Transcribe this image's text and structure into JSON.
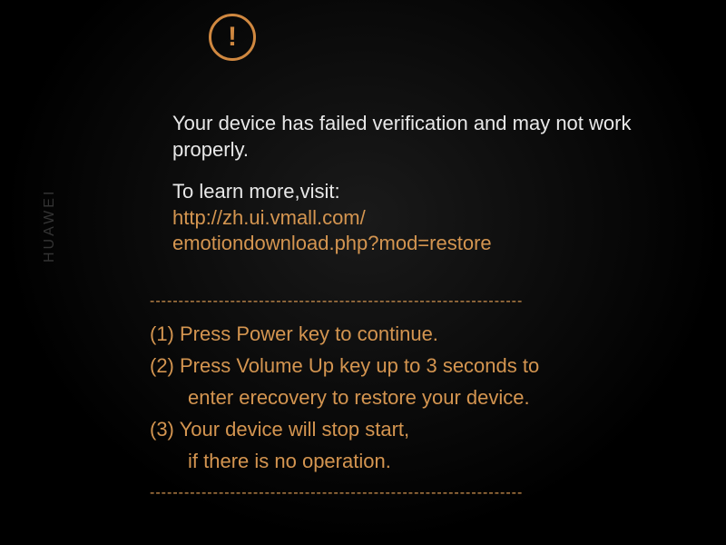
{
  "brand": "HUAWEI",
  "warning": {
    "symbol": "!",
    "message": "Your device has failed verification and may not work properly.",
    "visit_prompt": "To learn more,visit:",
    "url_line1": "http://zh.ui.vmall.com/",
    "url_line2": "emotiondownload.php?mod=restore"
  },
  "divider": "-----------------------------------------------------------------",
  "instructions": {
    "item1_line1": "(1) Press Power key to continue.",
    "item2_line1": "(2) Press Volume Up key up to 3 seconds to",
    "item2_line2": "enter erecovery to restore your device.",
    "item3_line1": "(3) Your device will stop start,",
    "item3_line2": "if there is no operation."
  }
}
